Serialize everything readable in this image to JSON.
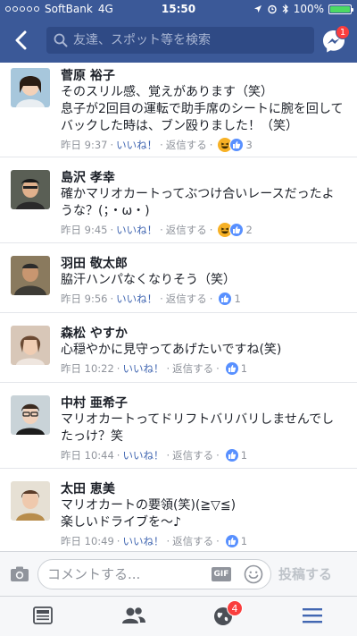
{
  "status_bar": {
    "carrier": "SoftBank",
    "network": "4G",
    "time": "15:50",
    "battery": "100%"
  },
  "header": {
    "search_placeholder": "友達、スポット等を検索",
    "messenger_badge": "1"
  },
  "comments": [
    {
      "name": "菅原 裕子",
      "text_lines": [
        "そのスリル感、覚えがあります（笑）",
        "息子が2回目の運転で助手席のシートに腕を回して",
        "バックした時は、ブン殴りました！（笑）"
      ],
      "time": "昨日 9:37",
      "like": "いいね！",
      "reply": "返信する",
      "reactions": [
        "haha",
        "like"
      ],
      "count": "3"
    },
    {
      "name": "島沢 孝幸",
      "text_lines": [
        "確かマリオカートってぶつけ合いレースだったよ",
        "うな？(；・ω・)"
      ],
      "time": "昨日 9:45",
      "like": "いいね！",
      "reply": "返信する",
      "reactions": [
        "haha",
        "like"
      ],
      "count": "2"
    },
    {
      "name": "羽田 敬太郎",
      "text_lines": [
        "脇汗ハンパなくなりそう（笑）"
      ],
      "time": "昨日 9:56",
      "like": "いいね！",
      "reply": "返信する",
      "reactions": [
        "like"
      ],
      "count": "1"
    },
    {
      "name": "森松 やすか",
      "text_lines": [
        "心穏やかに見守ってあげたいですね(笑)"
      ],
      "time": "昨日 10:22",
      "like": "いいね！",
      "reply": "返信する",
      "reactions": [
        "like"
      ],
      "count": "1"
    },
    {
      "name": "中村 亜希子",
      "text_lines": [
        "マリオカートってドリフトバリバリしませんでし",
        "たっけ？笑"
      ],
      "time": "昨日 10:44",
      "like": "いいね！",
      "reply": "返信する",
      "reactions": [
        "like"
      ],
      "count": "1"
    },
    {
      "name": "太田 恵美",
      "text_lines": [
        "マリオカートの要領(笑)(≧▽≦)",
        "楽しいドライブを〜♪"
      ],
      "time": "昨日 10:49",
      "like": "いいね！",
      "reply": "返信する",
      "reactions": [
        "like"
      ],
      "count": "1"
    }
  ],
  "input_bar": {
    "placeholder": "コメントする...",
    "gif_label": "GIF",
    "post_label": "投稿する"
  },
  "tabbar": {
    "notifications_badge": "4"
  },
  "colors": {
    "brand": "#3b5998",
    "like_text": "#4267b2",
    "badge": "#fa3e3e"
  }
}
